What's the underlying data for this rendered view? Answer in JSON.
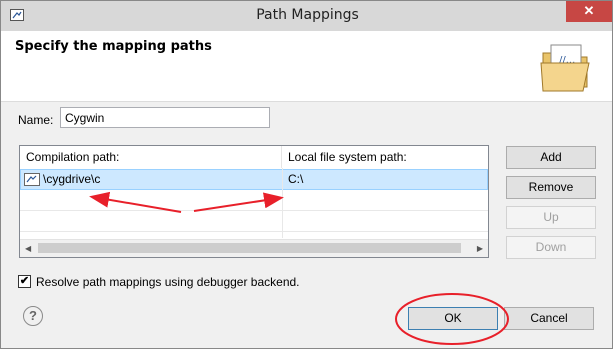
{
  "window": {
    "title": "Path Mappings",
    "close_label": "✕"
  },
  "banner": {
    "title": "Specify the mapping paths",
    "icon": "folder-icon"
  },
  "name": {
    "label": "Name:",
    "value": "Cygwin"
  },
  "table": {
    "columns": [
      "Compilation path:",
      "Local file system path:"
    ],
    "rows": [
      {
        "compilation": "\\cygdrive\\c",
        "local": "C:\\"
      }
    ]
  },
  "buttons": {
    "add": "Add",
    "remove": "Remove",
    "up": "Up",
    "down": "Down",
    "ok": "OK",
    "cancel": "Cancel"
  },
  "checkbox": {
    "label": "Resolve path mappings using debugger backend.",
    "checked": true,
    "mark": "✔"
  },
  "help": {
    "label": "?"
  },
  "colors": {
    "annotation": "#e8202a",
    "selection": "#cde8ff",
    "close": "#c74744"
  }
}
